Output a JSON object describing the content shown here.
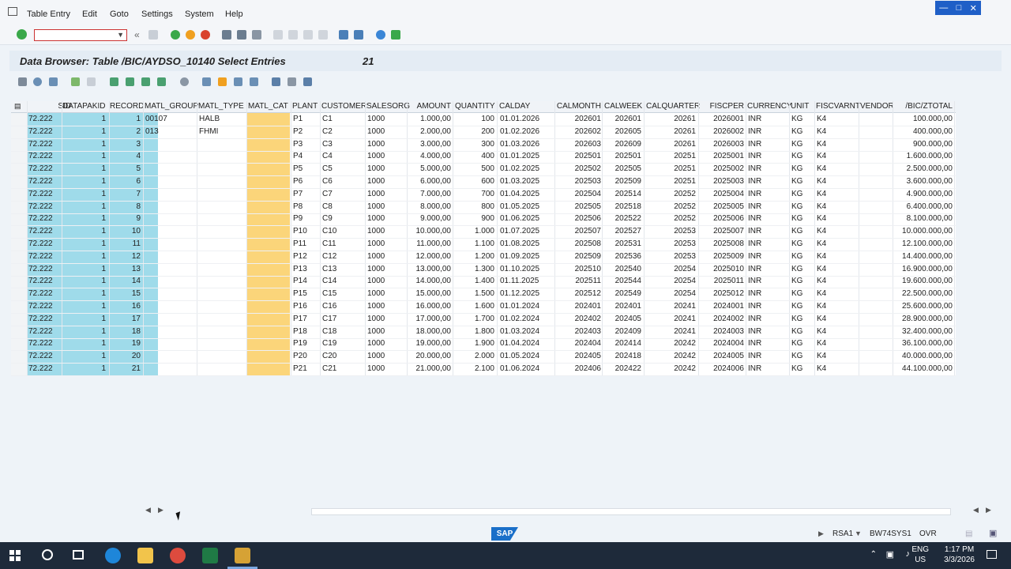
{
  "menu": {
    "items": [
      "Table Entry",
      "Edit",
      "Goto",
      "Settings",
      "System",
      "Help"
    ]
  },
  "command_field": {
    "value": "",
    "placeholder": ""
  },
  "title": {
    "text": "Data Browser: Table /BIC/AYDSO_10140 Select Entries",
    "count": "21"
  },
  "table": {
    "columns": [
      "SID",
      "DATAPAKID",
      "RECORD",
      "MATL_GROUP",
      "MATL_TYPE",
      "MATL_CAT",
      "PLANT",
      "CUSTOMER",
      "SALESORG",
      "AMOUNT",
      "QUANTITY",
      "CALDAY",
      "CALMONTH",
      "CALWEEK",
      "CALQUARTER",
      "FISCPER",
      "CURRENCY",
      "UNIT",
      "FISCVARNT",
      "VENDOR",
      "/BIC/ZTOTAL"
    ],
    "rows": [
      [
        "72.222",
        "1",
        "1",
        "00107",
        "HALB",
        "",
        "P1",
        "C1",
        "1000",
        "1.000,00",
        "100",
        "01.01.2026",
        "202601",
        "202601",
        "20261",
        "2026001",
        "INR",
        "KG",
        "K4",
        "",
        "100.000,00"
      ],
      [
        "72.222",
        "1",
        "2",
        "013",
        "FHMI",
        "",
        "P2",
        "C2",
        "1000",
        "2.000,00",
        "200",
        "01.02.2026",
        "202602",
        "202605",
        "20261",
        "2026002",
        "INR",
        "KG",
        "K4",
        "",
        "400.000,00"
      ],
      [
        "72.222",
        "1",
        "3",
        "",
        "",
        "",
        "P3",
        "C3",
        "1000",
        "3.000,00",
        "300",
        "01.03.2026",
        "202603",
        "202609",
        "20261",
        "2026003",
        "INR",
        "KG",
        "K4",
        "",
        "900.000,00"
      ],
      [
        "72.222",
        "1",
        "4",
        "",
        "",
        "",
        "P4",
        "C4",
        "1000",
        "4.000,00",
        "400",
        "01.01.2025",
        "202501",
        "202501",
        "20251",
        "2025001",
        "INR",
        "KG",
        "K4",
        "",
        "1.600.000,00"
      ],
      [
        "72.222",
        "1",
        "5",
        "",
        "",
        "",
        "P5",
        "C5",
        "1000",
        "5.000,00",
        "500",
        "01.02.2025",
        "202502",
        "202505",
        "20251",
        "2025002",
        "INR",
        "KG",
        "K4",
        "",
        "2.500.000,00"
      ],
      [
        "72.222",
        "1",
        "6",
        "",
        "",
        "",
        "P6",
        "C6",
        "1000",
        "6.000,00",
        "600",
        "01.03.2025",
        "202503",
        "202509",
        "20251",
        "2025003",
        "INR",
        "KG",
        "K4",
        "",
        "3.600.000,00"
      ],
      [
        "72.222",
        "1",
        "7",
        "",
        "",
        "",
        "P7",
        "C7",
        "1000",
        "7.000,00",
        "700",
        "01.04.2025",
        "202504",
        "202514",
        "20252",
        "2025004",
        "INR",
        "KG",
        "K4",
        "",
        "4.900.000,00"
      ],
      [
        "72.222",
        "1",
        "8",
        "",
        "",
        "",
        "P8",
        "C8",
        "1000",
        "8.000,00",
        "800",
        "01.05.2025",
        "202505",
        "202518",
        "20252",
        "2025005",
        "INR",
        "KG",
        "K4",
        "",
        "6.400.000,00"
      ],
      [
        "72.222",
        "1",
        "9",
        "",
        "",
        "",
        "P9",
        "C9",
        "1000",
        "9.000,00",
        "900",
        "01.06.2025",
        "202506",
        "202522",
        "20252",
        "2025006",
        "INR",
        "KG",
        "K4",
        "",
        "8.100.000,00"
      ],
      [
        "72.222",
        "1",
        "10",
        "",
        "",
        "",
        "P10",
        "C10",
        "1000",
        "10.000,00",
        "1.000",
        "01.07.2025",
        "202507",
        "202527",
        "20253",
        "2025007",
        "INR",
        "KG",
        "K4",
        "",
        "10.000.000,00"
      ],
      [
        "72.222",
        "1",
        "11",
        "",
        "",
        "",
        "P11",
        "C11",
        "1000",
        "11.000,00",
        "1.100",
        "01.08.2025",
        "202508",
        "202531",
        "20253",
        "2025008",
        "INR",
        "KG",
        "K4",
        "",
        "12.100.000,00"
      ],
      [
        "72.222",
        "1",
        "12",
        "",
        "",
        "",
        "P12",
        "C12",
        "1000",
        "12.000,00",
        "1.200",
        "01.09.2025",
        "202509",
        "202536",
        "20253",
        "2025009",
        "INR",
        "KG",
        "K4",
        "",
        "14.400.000,00"
      ],
      [
        "72.222",
        "1",
        "13",
        "",
        "",
        "",
        "P13",
        "C13",
        "1000",
        "13.000,00",
        "1.300",
        "01.10.2025",
        "202510",
        "202540",
        "20254",
        "2025010",
        "INR",
        "KG",
        "K4",
        "",
        "16.900.000,00"
      ],
      [
        "72.222",
        "1",
        "14",
        "",
        "",
        "",
        "P14",
        "C14",
        "1000",
        "14.000,00",
        "1.400",
        "01.11.2025",
        "202511",
        "202544",
        "20254",
        "2025011",
        "INR",
        "KG",
        "K4",
        "",
        "19.600.000,00"
      ],
      [
        "72.222",
        "1",
        "15",
        "",
        "",
        "",
        "P15",
        "C15",
        "1000",
        "15.000,00",
        "1.500",
        "01.12.2025",
        "202512",
        "202549",
        "20254",
        "2025012",
        "INR",
        "KG",
        "K4",
        "",
        "22.500.000,00"
      ],
      [
        "72.222",
        "1",
        "16",
        "",
        "",
        "",
        "P16",
        "C16",
        "1000",
        "16.000,00",
        "1.600",
        "01.01.2024",
        "202401",
        "202401",
        "20241",
        "2024001",
        "INR",
        "KG",
        "K4",
        "",
        "25.600.000,00"
      ],
      [
        "72.222",
        "1",
        "17",
        "",
        "",
        "",
        "P17",
        "C17",
        "1000",
        "17.000,00",
        "1.700",
        "01.02.2024",
        "202402",
        "202405",
        "20241",
        "2024002",
        "INR",
        "KG",
        "K4",
        "",
        "28.900.000,00"
      ],
      [
        "72.222",
        "1",
        "18",
        "",
        "",
        "",
        "P18",
        "C18",
        "1000",
        "18.000,00",
        "1.800",
        "01.03.2024",
        "202403",
        "202409",
        "20241",
        "2024003",
        "INR",
        "KG",
        "K4",
        "",
        "32.400.000,00"
      ],
      [
        "72.222",
        "1",
        "19",
        "",
        "",
        "",
        "P19",
        "C19",
        "1000",
        "19.000,00",
        "1.900",
        "01.04.2024",
        "202404",
        "202414",
        "20242",
        "2024004",
        "INR",
        "KG",
        "K4",
        "",
        "36.100.000,00"
      ],
      [
        "72.222",
        "1",
        "20",
        "",
        "",
        "",
        "P20",
        "C20",
        "1000",
        "20.000,00",
        "2.000",
        "01.05.2024",
        "202405",
        "202418",
        "20242",
        "2024005",
        "INR",
        "KG",
        "K4",
        "",
        "40.000.000,00"
      ],
      [
        "72.222",
        "1",
        "21",
        "",
        "",
        "",
        "P21",
        "C21",
        "1000",
        "21.000,00",
        "2.100",
        "01.06.2024",
        "202406",
        "202422",
        "20242",
        "2024006",
        "INR",
        "KG",
        "K4",
        "",
        "44.100.000,00"
      ]
    ]
  },
  "status": {
    "transaction": "RSA1",
    "system": "BW74SYS1",
    "mode": "OVR"
  },
  "sap_logo": "SAP",
  "taskbar": {
    "lang_top": "ENG",
    "lang_bottom": "US",
    "time": "1:17 PM",
    "date": "3/3/2026"
  },
  "colors": {
    "key_column": "#9fdbea",
    "matl_cat_column": "#fbd57a",
    "accent": "#1f5fc7"
  }
}
